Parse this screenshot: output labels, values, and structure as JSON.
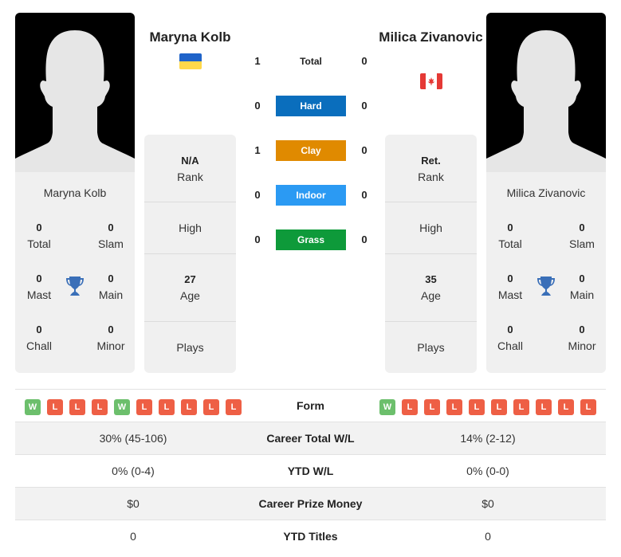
{
  "left_player": {
    "name": "Maryna Kolb",
    "flag": "ukraine-flag",
    "stats": {
      "total": {
        "value": "0",
        "label": "Total"
      },
      "slam": {
        "value": "0",
        "label": "Slam"
      },
      "mast": {
        "value": "0",
        "label": "Mast"
      },
      "main": {
        "value": "0",
        "label": "Main"
      },
      "chall": {
        "value": "0",
        "label": "Chall"
      },
      "minor": {
        "value": "0",
        "label": "Minor"
      }
    },
    "info": {
      "rank": {
        "value": "N/A",
        "label": "Rank"
      },
      "high": {
        "value": "",
        "label": "High"
      },
      "age": {
        "value": "27",
        "label": "Age"
      },
      "plays": {
        "value": "",
        "label": "Plays"
      }
    },
    "form": [
      "W",
      "L",
      "L",
      "L",
      "W",
      "L",
      "L",
      "L",
      "L",
      "L"
    ]
  },
  "right_player": {
    "name": "Milica Zivanovic",
    "flag": "canada-flag",
    "stats": {
      "total": {
        "value": "0",
        "label": "Total"
      },
      "slam": {
        "value": "0",
        "label": "Slam"
      },
      "mast": {
        "value": "0",
        "label": "Mast"
      },
      "main": {
        "value": "0",
        "label": "Main"
      },
      "chall": {
        "value": "0",
        "label": "Chall"
      },
      "minor": {
        "value": "0",
        "label": "Minor"
      }
    },
    "info": {
      "rank": {
        "value": "Ret.",
        "label": "Rank"
      },
      "high": {
        "value": "",
        "label": "High"
      },
      "age": {
        "value": "35",
        "label": "Age"
      },
      "plays": {
        "value": "",
        "label": "Plays"
      }
    },
    "form": [
      "W",
      "L",
      "L",
      "L",
      "L",
      "L",
      "L",
      "L",
      "L",
      "L"
    ]
  },
  "h2h": [
    {
      "label": "Total",
      "left": "1",
      "right": "0",
      "color": ""
    },
    {
      "label": "Hard",
      "left": "0",
      "right": "0",
      "color": "#0a6ebd"
    },
    {
      "label": "Clay",
      "left": "1",
      "right": "0",
      "color": "#e08a00"
    },
    {
      "label": "Indoor",
      "left": "0",
      "right": "0",
      "color": "#2b9af3"
    },
    {
      "label": "Grass",
      "left": "0",
      "right": "0",
      "color": "#0e9a3a"
    }
  ],
  "comparison": {
    "form_label": "Form",
    "rows": [
      {
        "label": "Career Total W/L",
        "left": "30% (45-106)",
        "right": "14% (2-12)"
      },
      {
        "label": "YTD W/L",
        "left": "0% (0-4)",
        "right": "0% (0-0)"
      },
      {
        "label": "Career Prize Money",
        "left": "$0",
        "right": "$0"
      },
      {
        "label": "YTD Titles",
        "left": "0",
        "right": "0"
      }
    ]
  },
  "colors": {
    "win": "#6cbf6c",
    "loss": "#ee5f45",
    "trophy": "#3a6fb8"
  }
}
